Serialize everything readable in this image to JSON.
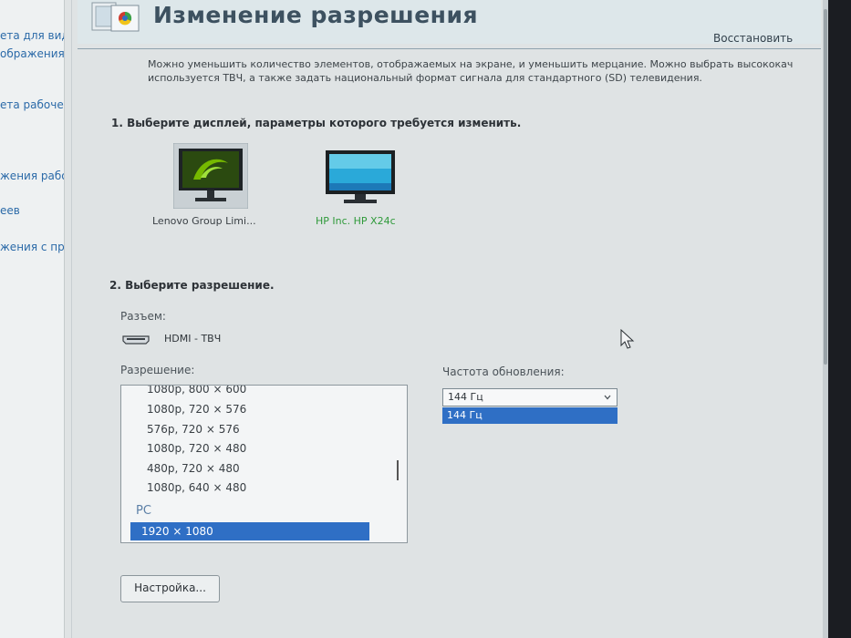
{
  "sidebar": {
    "links": [
      "ета для вид",
      "ображения д",
      "ета рабочег",
      "жения рабо",
      "еев",
      "жения с пр"
    ]
  },
  "header": {
    "title": "Изменение разрешения",
    "restore_label": "Восстановить"
  },
  "description": "Можно уменьшить количество элементов, отображаемых на экране, и уменьшить мерцание. Можно выбрать высококач используется ТВЧ, а также задать национальный формат сигнала для стандартного (SD) телевидения.",
  "section1": {
    "heading": "1. Выберите дисплей, параметры которого требуется изменить.",
    "displays": [
      {
        "label": "Lenovo Group Limi...",
        "selected": true,
        "icon": "monitor-nvidia-icon"
      },
      {
        "label": "HP Inc. HP X24c",
        "selected": false,
        "icon": "monitor-desktop-icon"
      }
    ]
  },
  "section2": {
    "heading": "2. Выберите разрешение.",
    "connector_label": "Разъем:",
    "connector_value": "HDMI - ТВЧ",
    "resolution_label": "Разрешение:",
    "resolutions": [
      "1080p, 800 × 600",
      "1080p, 720 × 576",
      "576p, 720 × 576",
      "1080p, 720 × 480",
      "480p, 720 × 480",
      "1080p, 640 × 480"
    ],
    "group_label": "PC",
    "selected_resolution": "1920 × 1080",
    "refresh_label": "Частота обновления:",
    "refresh_value": "144 Гц",
    "refresh_options": [
      "144 Гц"
    ]
  },
  "settings_button": "Настройка...",
  "colors": {
    "accent": "#2f6fc5",
    "link": "#2b6aa8",
    "nvidia_green": "#76b900",
    "selected_display_label": "#3a4045",
    "display_label": "#2f9a3a"
  }
}
